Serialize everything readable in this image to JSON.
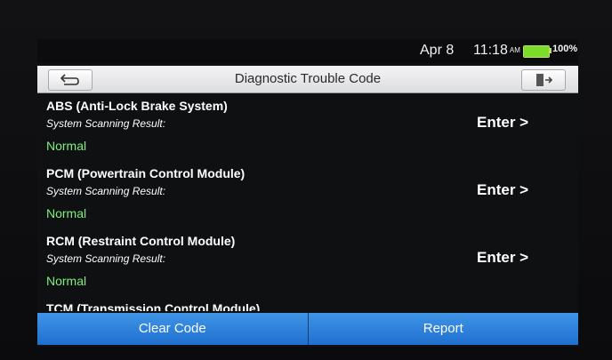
{
  "status": {
    "date": "Apr 8",
    "time": "11:18",
    "ampm": "AM",
    "battery_text": "100%",
    "battery_level": 1.0,
    "battery_color": "#7bdc2a"
  },
  "header": {
    "title": "Diagnostic Trouble Code",
    "back_icon": "back-arrow-icon",
    "exit_icon": "exit-door-icon"
  },
  "modules": [
    {
      "name": "ABS (Anti-Lock Brake System)",
      "scan_label": "System Scanning Result:",
      "result": "Normal",
      "enter": "Enter >"
    },
    {
      "name": "PCM (Powertrain Control Module)",
      "scan_label": "System Scanning Result:",
      "result": "Normal",
      "enter": "Enter >"
    },
    {
      "name": "RCM (Restraint Control Module)",
      "scan_label": "System Scanning Result:",
      "result": "Normal",
      "enter": "Enter >"
    },
    {
      "name": "TCM (Transmission Control Module)",
      "scan_label": "",
      "result": "",
      "enter": ""
    }
  ],
  "footer": {
    "clear_label": "Clear Code",
    "report_label": "Report"
  },
  "colors": {
    "result_normal": "#7df07d",
    "button_blue": "#2a80dc"
  }
}
